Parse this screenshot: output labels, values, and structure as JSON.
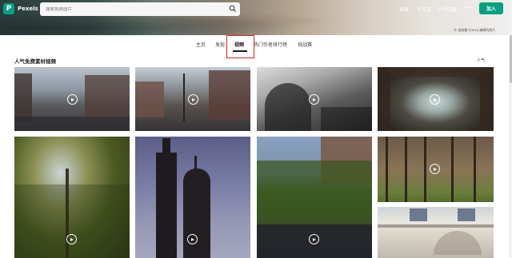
{
  "header": {
    "logo_letter": "P",
    "logo_text": "Pexels",
    "search_placeholder": "搜索免费图片",
    "nav_discover": "探索",
    "nav_license": "许可证",
    "nav_upload": "上传内容",
    "more_label": "···",
    "join_label": "加入",
    "photo_credit": "© 谁拍摄 Canva 编辑的照片"
  },
  "tabs": [
    {
      "label": "主页"
    },
    {
      "label": "发现"
    },
    {
      "label": "视频",
      "active": true
    },
    {
      "label": "热门作者排行榜"
    },
    {
      "label": "挑战赛"
    }
  ],
  "section": {
    "title": "人气免费素材视频",
    "sort_label": "人气"
  },
  "videos": [
    {
      "icon": "play-icon"
    },
    {
      "icon": "play-icon"
    },
    {
      "icon": "play-icon"
    },
    {
      "icon": "play-icon"
    },
    {
      "icon": "play-icon"
    },
    {
      "icon": "play-icon"
    },
    {
      "icon": "play-icon"
    },
    {
      "icon": "play-icon"
    },
    {
      "icon": "none"
    }
  ],
  "colors": {
    "brand": "#05a081",
    "highlight": "#e0241b"
  }
}
